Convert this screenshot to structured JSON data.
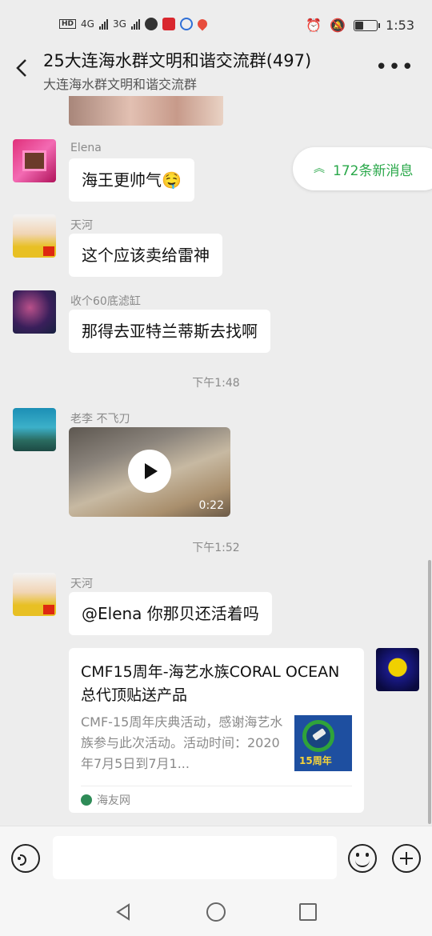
{
  "status_bar": {
    "time": "1:53",
    "network_badge": "HD",
    "signal1_label": "4G",
    "signal2_label": "3G",
    "battery_level": 0.35
  },
  "header": {
    "title": "25大连海水群文明和谐交流群(497)",
    "subtitle": "大连海水群文明和谐交流群"
  },
  "new_messages": {
    "label": "172条新消息"
  },
  "messages": [
    {
      "sender": "Elena",
      "text": "海王更帅气🤤"
    },
    {
      "sender": "天河",
      "text": "这个应该卖给雷神"
    },
    {
      "sender": "收个60底滤缸",
      "text": "那得去亚特兰蒂斯去找啊"
    },
    {
      "sender": "老李 不飞刀",
      "video_duration": "0:22"
    },
    {
      "sender": "天河",
      "text": "@Elena 你那贝还活着吗"
    }
  ],
  "timestamps": [
    "下午1:48",
    "下午1:52"
  ],
  "link_card": {
    "title": "CMF15周年-海艺水族CORAL OCEAN总代顶贴送产品",
    "description": "CMF-15周年庆典活动，感谢海艺水族参与此次活动。活动时间：2020年7月5日到7月1...",
    "thumb_text": "15周年",
    "source": "海友网"
  },
  "colors": {
    "accent_green": "#2aa84a",
    "chat_background": "#ededed",
    "bubble_background": "#ffffff"
  }
}
